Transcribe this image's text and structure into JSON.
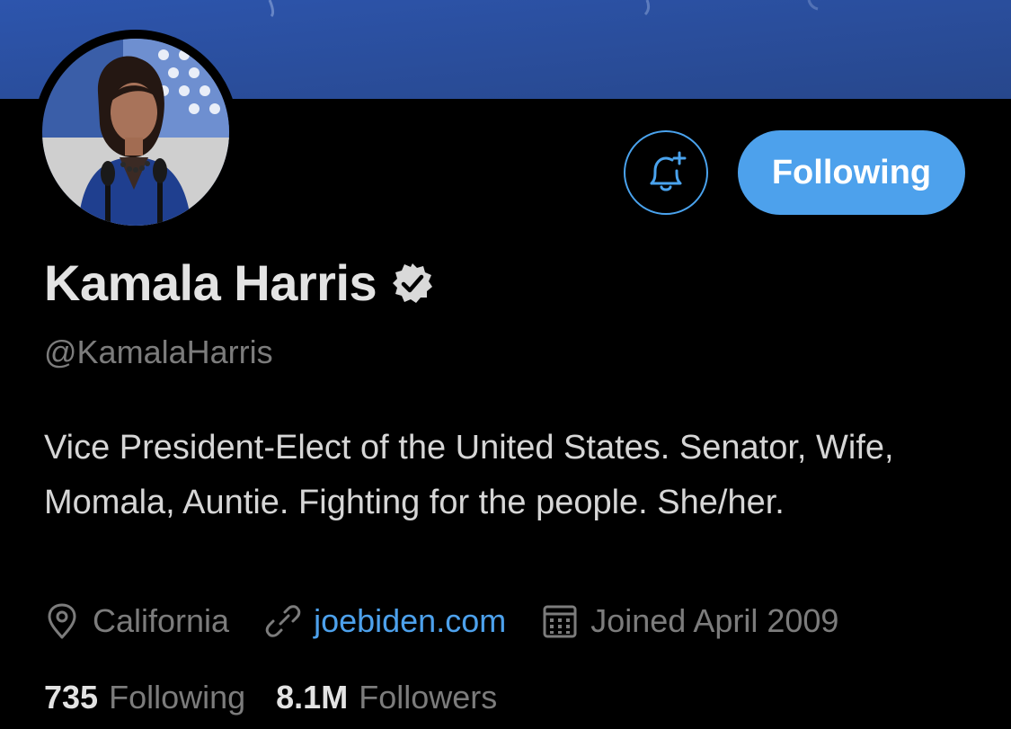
{
  "profile": {
    "display_name": "Kamala Harris",
    "handle": "@KamalaHarris",
    "verified": true,
    "bio": "Vice President-Elect of the United States. Senator, Wife, Momala, Auntie. Fighting for the people. She/her.",
    "location": "California",
    "website": "joebiden.com",
    "joined": "Joined April 2009"
  },
  "actions": {
    "notify_icon": "bell-plus-icon",
    "follow_label": "Following"
  },
  "stats": {
    "following_count": "735",
    "following_label": "Following",
    "followers_count": "8.1M",
    "followers_label": "Followers"
  },
  "colors": {
    "background": "#000000",
    "banner": "#2c52a8",
    "accent": "#4da1ec",
    "primary_text": "#e3e3e3",
    "secondary_text": "#7c7c7c"
  }
}
